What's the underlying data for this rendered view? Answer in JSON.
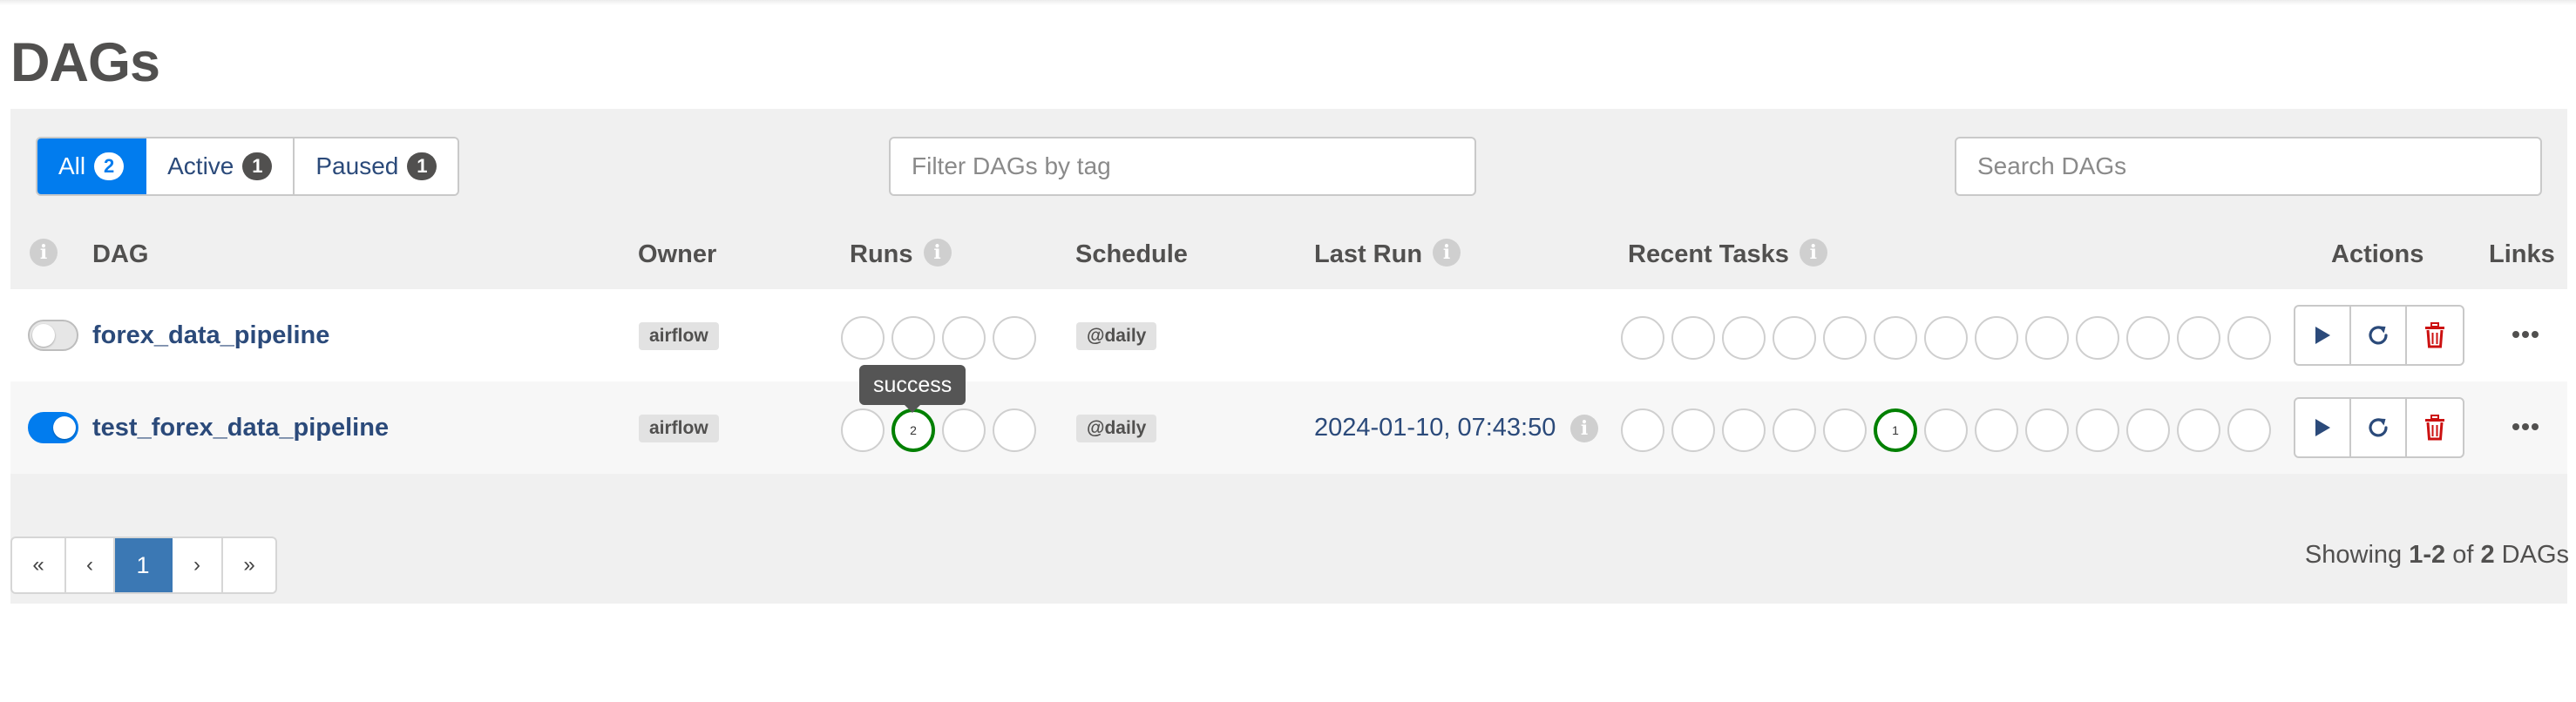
{
  "page": {
    "title": "DAGs"
  },
  "filters": {
    "all": {
      "label": "All",
      "count": "2"
    },
    "active": {
      "label": "Active",
      "count": "1"
    },
    "paused": {
      "label": "Paused",
      "count": "1"
    },
    "tag_placeholder": "Filter DAGs by tag",
    "search_placeholder": "Search DAGs"
  },
  "columns": {
    "info": "i",
    "dag": "DAG",
    "owner": "Owner",
    "runs": "Runs",
    "schedule": "Schedule",
    "last_run": "Last Run",
    "recent_tasks": "Recent Tasks",
    "actions": "Actions",
    "links": "Links"
  },
  "dags": [
    {
      "name": "forex_data_pipeline",
      "paused": true,
      "owner": "airflow",
      "schedule": "@daily",
      "last_run": "",
      "runs": [
        "",
        "",
        "",
        ""
      ],
      "recent_tasks": [
        "",
        "",
        "",
        "",
        "",
        "",
        "",
        "",
        "",
        "",
        "",
        "",
        ""
      ]
    },
    {
      "name": "test_forex_data_pipeline",
      "paused": false,
      "owner": "airflow",
      "schedule": "@daily",
      "last_run": "2024-01-10, 07:43:50",
      "runs": [
        "",
        "2",
        "",
        ""
      ],
      "recent_tasks": [
        "",
        "",
        "",
        "",
        "",
        "1",
        "",
        "",
        "",
        "",
        "",
        "",
        ""
      ]
    }
  ],
  "tooltip": "success",
  "status_colors": {
    "success": "#008000",
    "accent": "#017cee",
    "delete": "#cc1111"
  },
  "icons": {
    "trigger": "play-icon",
    "refresh": "refresh-icon",
    "delete": "trash-icon",
    "links": "ellipsis-icon"
  },
  "pagination": {
    "first": "«",
    "prev": "‹",
    "current": "1",
    "next": "›",
    "last": "»"
  },
  "footer": {
    "showing": "Showing",
    "range": "1-2",
    "of": "of",
    "total": "2",
    "unit": "DAGs"
  }
}
